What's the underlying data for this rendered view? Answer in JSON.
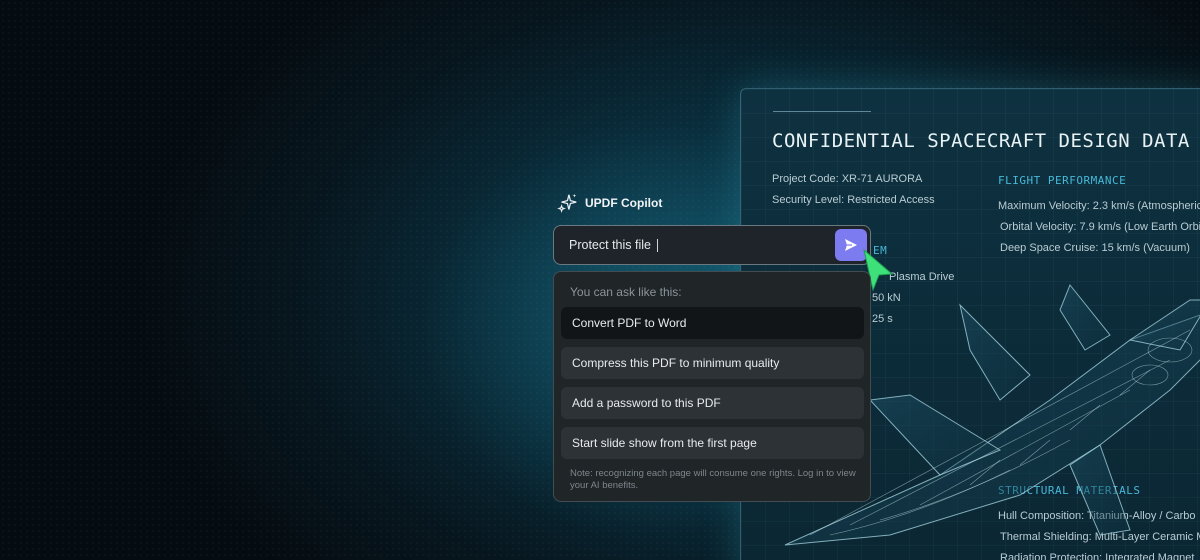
{
  "document": {
    "title": "CONFIDENTIAL SPACECRAFT DESIGN DATA",
    "project_code": "Project Code: XR-71 AURORA",
    "security_level": "Security Level: Restricted Access",
    "flight_performance": {
      "heading": "FLIGHT PERFORMANCE",
      "items": [
        "Maximum Velocity: 2.3 km/s (Atmospheric",
        "Orbital Velocity: 7.9 km/s (Low Earth Orbi",
        "Deep Space Cruise: 15 km/s (Vacuum)"
      ]
    },
    "propulsion_fragments": {
      "heading": "EM",
      "items": [
        "Plasma Drive",
        "50 kN",
        "25 s"
      ]
    },
    "structural_materials": {
      "heading": "STRUCTURAL MATERIALS",
      "items": [
        "Hull Composition: Titanium-Alloy / Carbo",
        "Thermal Shielding: Multi-Layer Ceramic M",
        "Radiation Protection: Integrated Magnet"
      ]
    }
  },
  "copilot": {
    "title": "UPDF Copilot",
    "prompt_value": "Protect this file",
    "send_icon": "send-icon",
    "suggestions_heading": "You can ask like this:",
    "suggestions": [
      "Convert PDF to Word",
      "Compress this PDF to minimum quality",
      "Add a password to this PDF",
      "Start slide show from the first page"
    ],
    "note": "Note: recognizing each page will consume one rights. Log in to view your AI benefits."
  },
  "colors": {
    "accent_send": "#7c7cf0",
    "cursor": "#3ee07a",
    "doc_heading": "#46b8d8"
  }
}
